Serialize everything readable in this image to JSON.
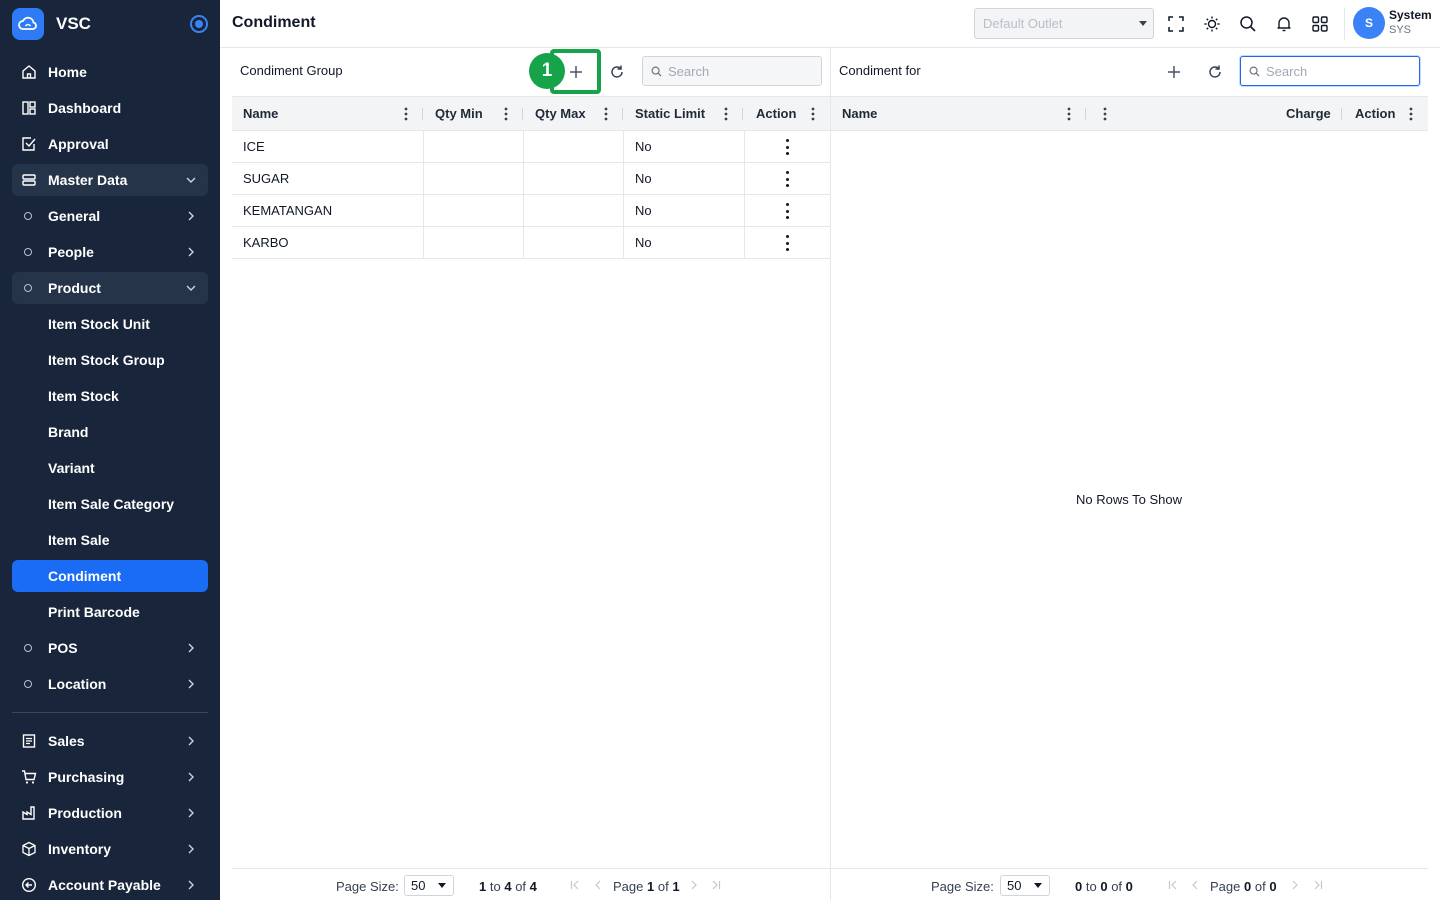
{
  "app": {
    "name": "VSC"
  },
  "header": {
    "title": "Condiment",
    "outlet_placeholder": "Default Outlet",
    "user_initial": "S",
    "user_name": "System",
    "user_code": "SYS"
  },
  "sidebar": {
    "items": [
      {
        "label": "Home"
      },
      {
        "label": "Dashboard"
      },
      {
        "label": "Approval"
      },
      {
        "label": "Master Data"
      },
      {
        "label": "General"
      },
      {
        "label": "People"
      },
      {
        "label": "Product"
      },
      {
        "label": "Item Stock Unit"
      },
      {
        "label": "Item Stock Group"
      },
      {
        "label": "Item Stock"
      },
      {
        "label": "Brand"
      },
      {
        "label": "Variant"
      },
      {
        "label": "Item Sale Category"
      },
      {
        "label": "Item Sale"
      },
      {
        "label": "Condiment"
      },
      {
        "label": "Print Barcode"
      },
      {
        "label": "POS"
      },
      {
        "label": "Location"
      },
      {
        "label": "Sales"
      },
      {
        "label": "Purchasing"
      },
      {
        "label": "Production"
      },
      {
        "label": "Inventory"
      },
      {
        "label": "Account Payable"
      }
    ]
  },
  "left_panel": {
    "title": "Condiment Group",
    "search_placeholder": "Search",
    "step_marker": "1",
    "columns": [
      "Name",
      "Qty Min",
      "Qty Max",
      "Static Limit",
      "Action"
    ],
    "rows": [
      {
        "name": "ICE",
        "qty_min": "",
        "qty_max": "",
        "static_limit": "No"
      },
      {
        "name": "SUGAR",
        "qty_min": "",
        "qty_max": "",
        "static_limit": "No"
      },
      {
        "name": "KEMATANGAN",
        "qty_min": "",
        "qty_max": "",
        "static_limit": "No"
      },
      {
        "name": "KARBO",
        "qty_min": "",
        "qty_max": "",
        "static_limit": "No"
      }
    ],
    "footer": {
      "page_size_label": "Page Size:",
      "page_size": "50",
      "range_from": "1",
      "range_to": "4",
      "range_total": "4",
      "to_word": "to",
      "of_word": "of",
      "page_word": "Page",
      "page": "1",
      "pages": "1"
    }
  },
  "right_panel": {
    "title": "Condiment for",
    "search_placeholder": "Search",
    "columns": [
      "Name",
      "Charge",
      "Action"
    ],
    "empty_text": "No Rows To Show",
    "footer": {
      "page_size_label": "Page Size:",
      "page_size": "50",
      "range_from": "0",
      "range_to": "0",
      "range_total": "0",
      "to_word": "to",
      "of_word": "of",
      "page_word": "Page",
      "page": "0",
      "pages": "0"
    }
  },
  "colors": {
    "sidebar_bg": "#18253a",
    "active_item": "#1a6cf5",
    "highlight_green": "#16a34a",
    "focus_blue": "#2563eb"
  }
}
